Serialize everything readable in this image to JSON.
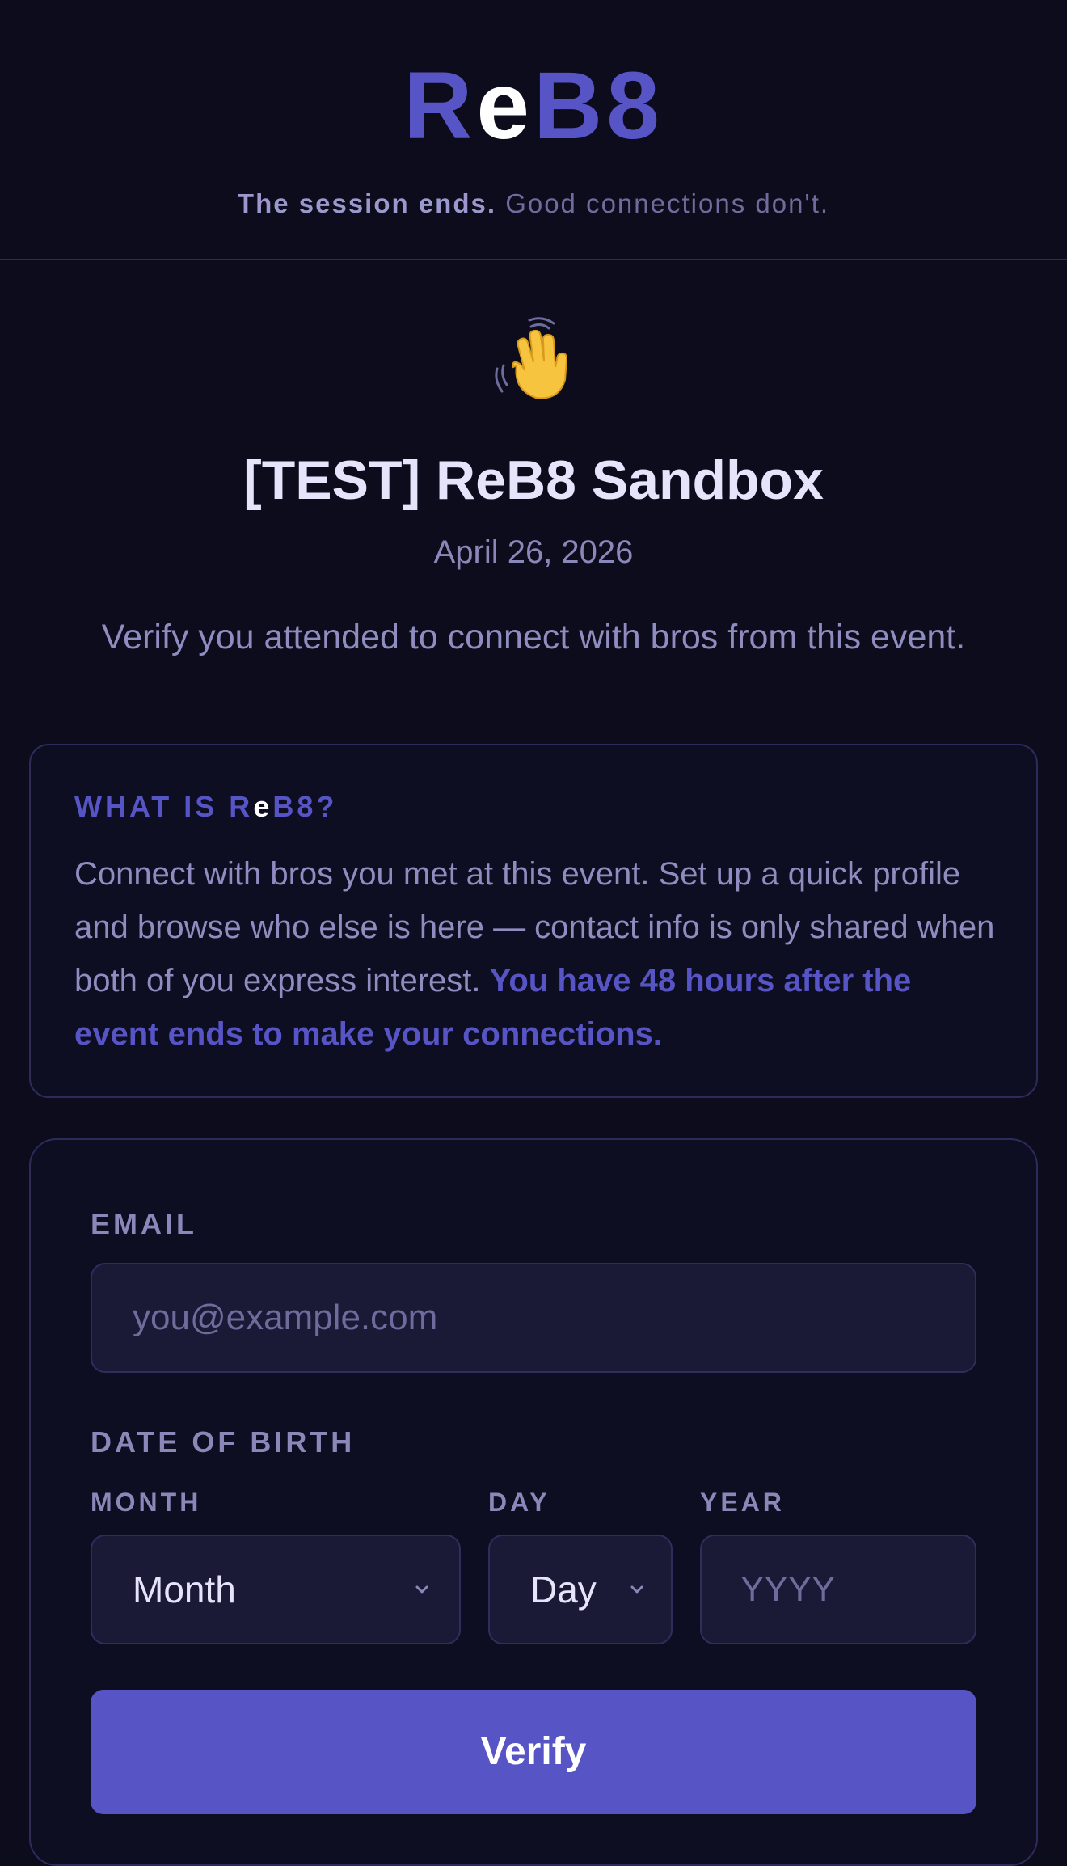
{
  "header": {
    "logo": {
      "part1": "R",
      "part2": "e",
      "part3": "B8"
    },
    "tagline": {
      "bold": "The session ends.",
      "light": "Good connections don't."
    }
  },
  "event": {
    "title": "[TEST] ReB8 Sandbox",
    "date": "April 26, 2026",
    "intro": "Verify you attended to connect with bros from this event."
  },
  "info": {
    "heading": {
      "prefix": "WHAT IS R",
      "mid": "e",
      "suffix": "B8?"
    },
    "body": "Connect with bros you met at this event. Set up a quick profile and browse who else is here — contact info is only shared when both of you express interest.",
    "emphasis": "You have 48 hours after the event ends to make your connections."
  },
  "form": {
    "email_label": "EMAIL",
    "email_value": "",
    "email_placeholder": "you@example.com",
    "dob_label": "DATE OF BIRTH",
    "month_label": "MONTH",
    "month_value": "Month",
    "day_label": "DAY",
    "day_value": "Day",
    "year_label": "YEAR",
    "year_value": "",
    "year_placeholder": "YYYY",
    "verify_label": "Verify"
  },
  "icons": {
    "wave": "waving-hand-icon",
    "month_chevron": "chevron-down-icon",
    "day_chevron": "chevron-down-icon"
  },
  "colors": {
    "background": "#0c0c1c",
    "accent": "#5754c6",
    "muted_text": "#8f8dc0",
    "border": "#2d2b5a",
    "input_bg": "#1a1a36"
  }
}
